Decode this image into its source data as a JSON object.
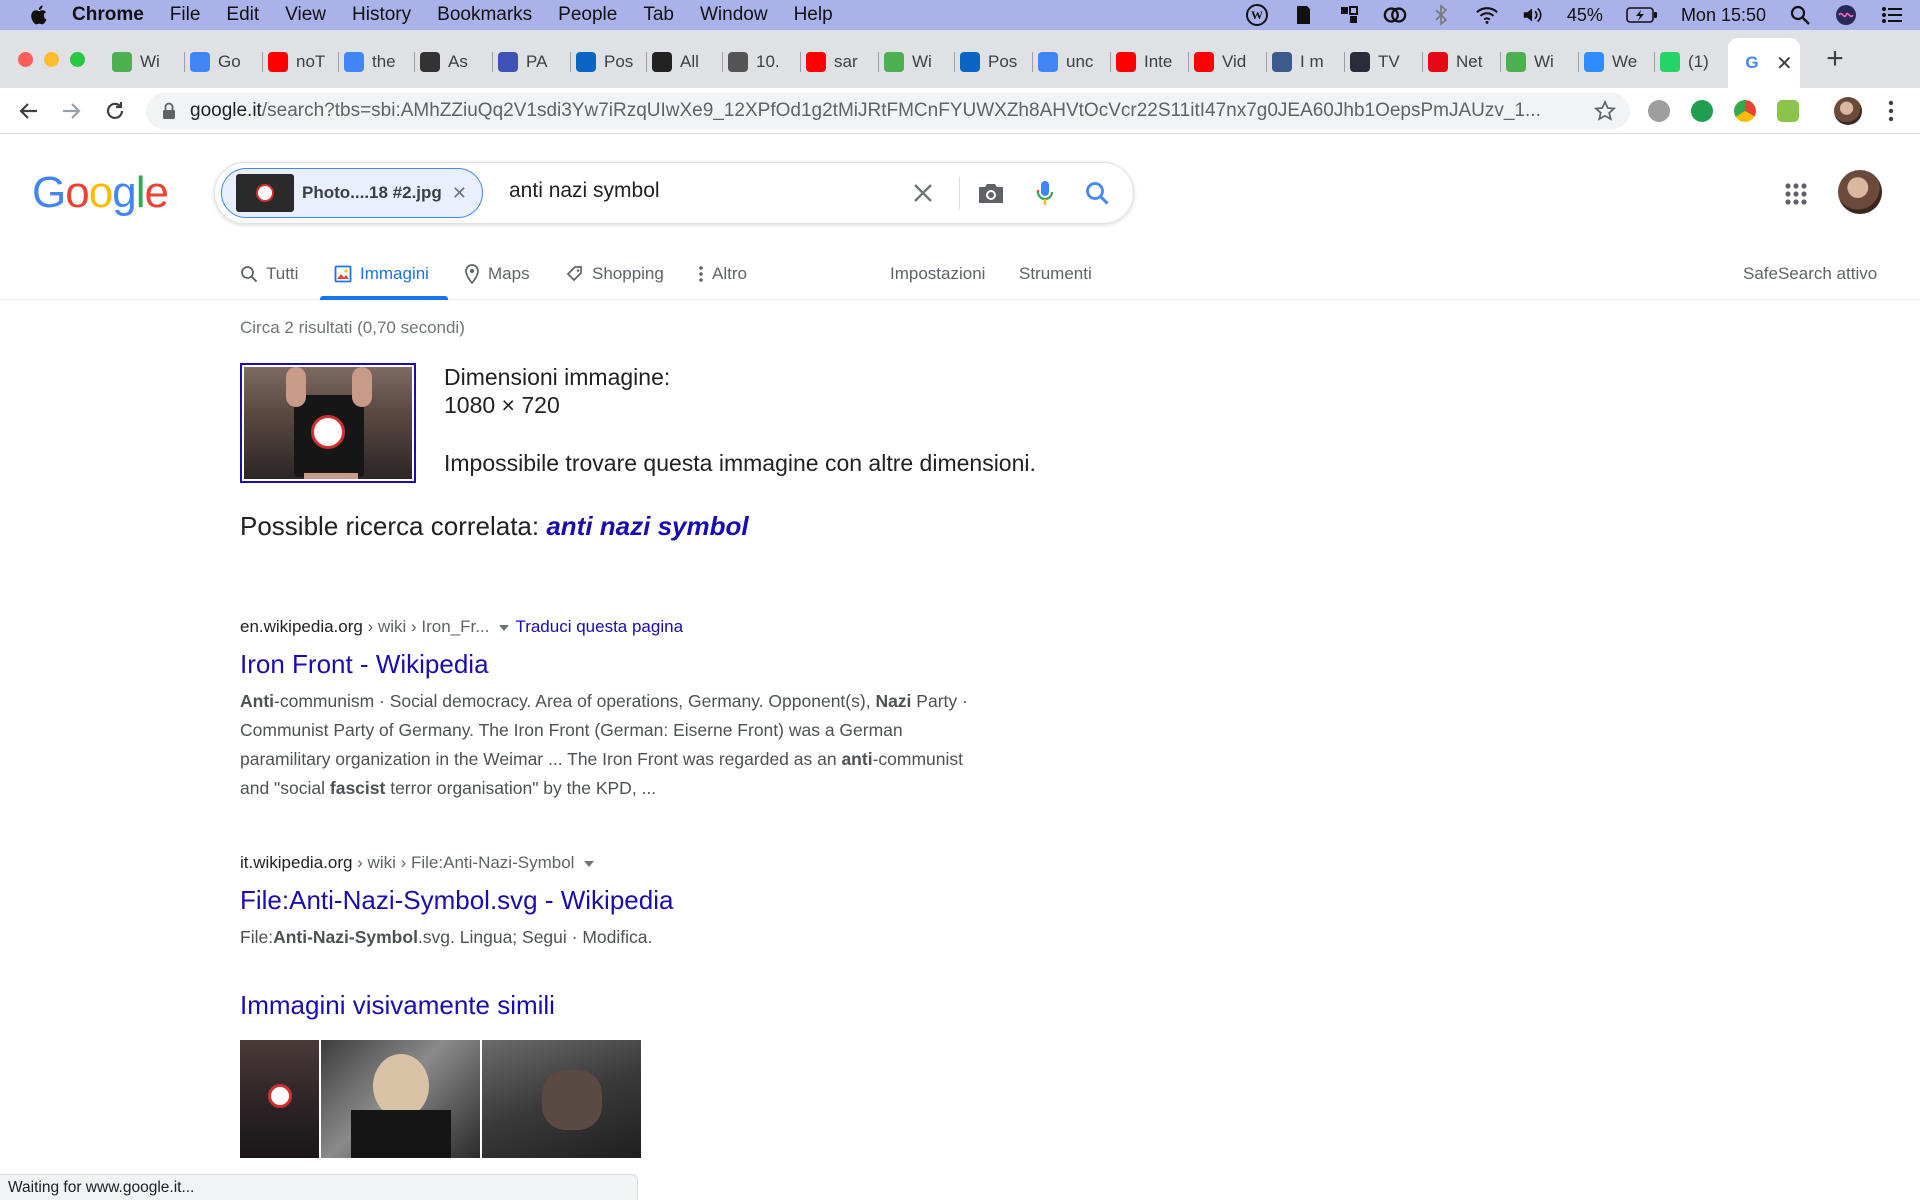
{
  "menubar": {
    "app": "Chrome",
    "items": [
      "File",
      "Edit",
      "View",
      "History",
      "Bookmarks",
      "People",
      "Tab",
      "Window",
      "Help"
    ],
    "battery": "45%",
    "clock": "Mon 15:50"
  },
  "tabs": [
    {
      "label": "Wi",
      "icon": "torrent-icon",
      "color": "#4caf50"
    },
    {
      "label": "Go",
      "icon": "google-icon",
      "color": "#4285f4"
    },
    {
      "label": "noT",
      "icon": "youtube-icon",
      "color": "#ff0000"
    },
    {
      "label": "the",
      "icon": "docs-icon",
      "color": "#4285f4"
    },
    {
      "label": "As",
      "icon": "wikipedia-icon",
      "color": "#333333"
    },
    {
      "label": "PA",
      "icon": "m-icon",
      "color": "#3f51b5"
    },
    {
      "label": "Pos",
      "icon": "outlook-icon",
      "color": "#0a66c2"
    },
    {
      "label": "All",
      "icon": "v-icon",
      "color": "#222222"
    },
    {
      "label": "10.",
      "icon": "globe-icon",
      "color": "#555555"
    },
    {
      "label": "sar",
      "icon": "youtube-icon",
      "color": "#ff0000"
    },
    {
      "label": "Wi",
      "icon": "torrent-icon",
      "color": "#4caf50"
    },
    {
      "label": "Pos",
      "icon": "outlook-icon",
      "color": "#0a66c2"
    },
    {
      "label": "unc",
      "icon": "google-icon",
      "color": "#4285f4"
    },
    {
      "label": "Inte",
      "icon": "youtube-icon",
      "color": "#ff0000"
    },
    {
      "label": "Vid",
      "icon": "youtube-icon",
      "color": "#ff0000"
    },
    {
      "label": "I m",
      "icon": "image-icon",
      "color": "#3b5b8c"
    },
    {
      "label": "TV",
      "icon": "premiere-icon",
      "color": "#2b2b3b"
    },
    {
      "label": "Net",
      "icon": "netflix-icon",
      "color": "#e50914"
    },
    {
      "label": "Wi",
      "icon": "torrent-icon",
      "color": "#4caf50"
    },
    {
      "label": "We",
      "icon": "zoom-icon",
      "color": "#2d8cff"
    },
    {
      "label": "(1)",
      "icon": "notification-icon",
      "color": "#25d366"
    }
  ],
  "omnibox": {
    "domain": "google.it",
    "path": "/search?tbs=sbi:AMhZZiuQq2V1sdi3Yw7iRzqUIwXe9_12XPfOd1g2tMiJRtFMCnFYUWXZh8AHVtOcVcr22S11itI47nx7g0JEA60Jhb1OepsPmJAUzv_1..."
  },
  "search": {
    "chip_label": "Photo....18 #2.jpg",
    "query": "anti nazi symbol"
  },
  "search_tabs": {
    "tutti": "Tutti",
    "immagini": "Immagini",
    "maps": "Maps",
    "shopping": "Shopping",
    "altro": "Altro",
    "impostazioni": "Impostazioni",
    "strumenti": "Strumenti",
    "safesearch": "SafeSearch attivo"
  },
  "results_info": {
    "stats": "Circa 2 risultati (0,70 secondi)",
    "dim_title": "Dimensioni immagine:",
    "dim_value": "1080 × 720",
    "dim_note": "Impossibile trovare questa immagine con altre dimensioni.",
    "related_prefix": "Possible ricerca correlata: ",
    "related_link": "anti nazi symbol"
  },
  "results": [
    {
      "domain": "en.wikipedia.org",
      "path": " › wiki › Iron_Fr...",
      "translate": "Traduci questa pagina",
      "title": "Iron Front - Wikipedia",
      "snippet_lines": [
        [
          "",
          "Anti",
          "-communism · Social democracy. Area of operations, Germany. Opponent(s), ",
          "Nazi",
          " Party ·"
        ],
        [
          "Communist Party of Germany. The Iron Front (German: Eiserne Front) was a German"
        ],
        [
          "paramilitary organization in the Weimar ... The Iron Front was regarded as an ",
          "anti",
          "-communist"
        ],
        [
          "and \"social ",
          "fascist",
          " terror organisation\" by the KPD, ..."
        ]
      ]
    },
    {
      "domain": "it.wikipedia.org",
      "path": " › wiki › File:Anti-Nazi-Symbol",
      "translate": "",
      "title": "File:Anti-Nazi-Symbol.svg - Wikipedia",
      "snippet_lines": [
        [
          "File:",
          "Anti-Nazi-Symbol",
          ".svg. Lingua; Segui · Modifica."
        ]
      ]
    }
  ],
  "similar": {
    "title": "Immagini visivamente simili"
  },
  "status": "Waiting for www.google.it..."
}
